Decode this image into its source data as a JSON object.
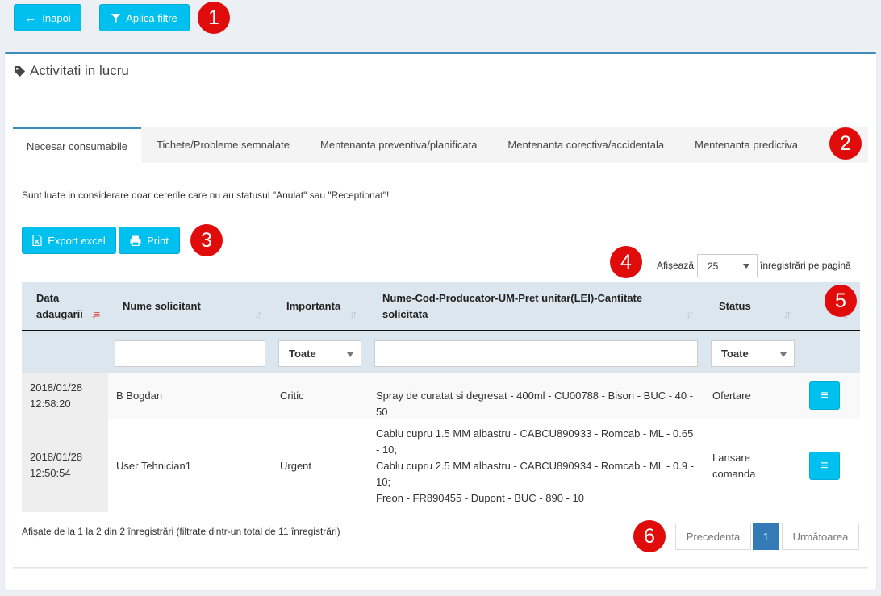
{
  "toolbar": {
    "back_label": "Inapoi",
    "filter_label": "Aplica filtre"
  },
  "markers": [
    "1",
    "2",
    "3",
    "4",
    "5",
    "6"
  ],
  "box": {
    "title": "Activitati in lucru"
  },
  "tabs": [
    {
      "label": "Necesar consumabile",
      "active": true
    },
    {
      "label": "Tichete/Probleme semnalate"
    },
    {
      "label": "Mentenanta preventiva/planificata"
    },
    {
      "label": "Mentenanta corectiva/accidentala"
    },
    {
      "label": "Mentenanta predictiva"
    }
  ],
  "note": "Sunt luate in considerare doar cererile care nu au statusul \"Anulat\" sau \"Receptionat\"!",
  "actions": {
    "export_label": "Export excel",
    "print_label": "Print"
  },
  "page_length": {
    "prefix": "Afișează",
    "value": "25",
    "suffix": "înregistrări pe pagină"
  },
  "table": {
    "headers": [
      "Data adaugarii",
      "Nume solicitant",
      "Importanta",
      "Nume-Cod-Producator-UM-Pret unitar(LEI)-Cantitate solicitata",
      "Status"
    ],
    "filters": {
      "importanta": "Toate",
      "status": "Toate"
    },
    "rows": [
      {
        "date": "2018/01/28",
        "time": "12:58:20",
        "name": "B Bogdan",
        "importance": "Critic",
        "items": [
          "Spray de curatat si degresat - 400ml - CU00788 - Bison - BUC - 40 - 50"
        ],
        "status": "Ofertare"
      },
      {
        "date": "2018/01/28",
        "time": "12:50:54",
        "name": "User Tehnician1",
        "importance": "Urgent",
        "items": [
          "Cablu cupru 1.5 MM albastru - CABCU890933 - Romcab - ML - 0.65 - 10;",
          "Cablu cupru 2.5 MM albastru - CABCU890934 - Romcab - ML - 0.9 - 10;",
          "Freon - FR890455 - Dupont - BUC - 890 - 10"
        ],
        "status": "Lansare comanda"
      }
    ]
  },
  "info": "Afișate de la 1 la 2 din 2 înregistrări (filtrate dintr-un total de 11 înregistrări)",
  "pagination": {
    "prev": "Precedenta",
    "current": "1",
    "next": "Următoarea"
  },
  "colors": {
    "accent": "#00c0ef",
    "primary": "#3c8dbc",
    "marker": "#e00b0b",
    "page_active": "#337ab7"
  }
}
